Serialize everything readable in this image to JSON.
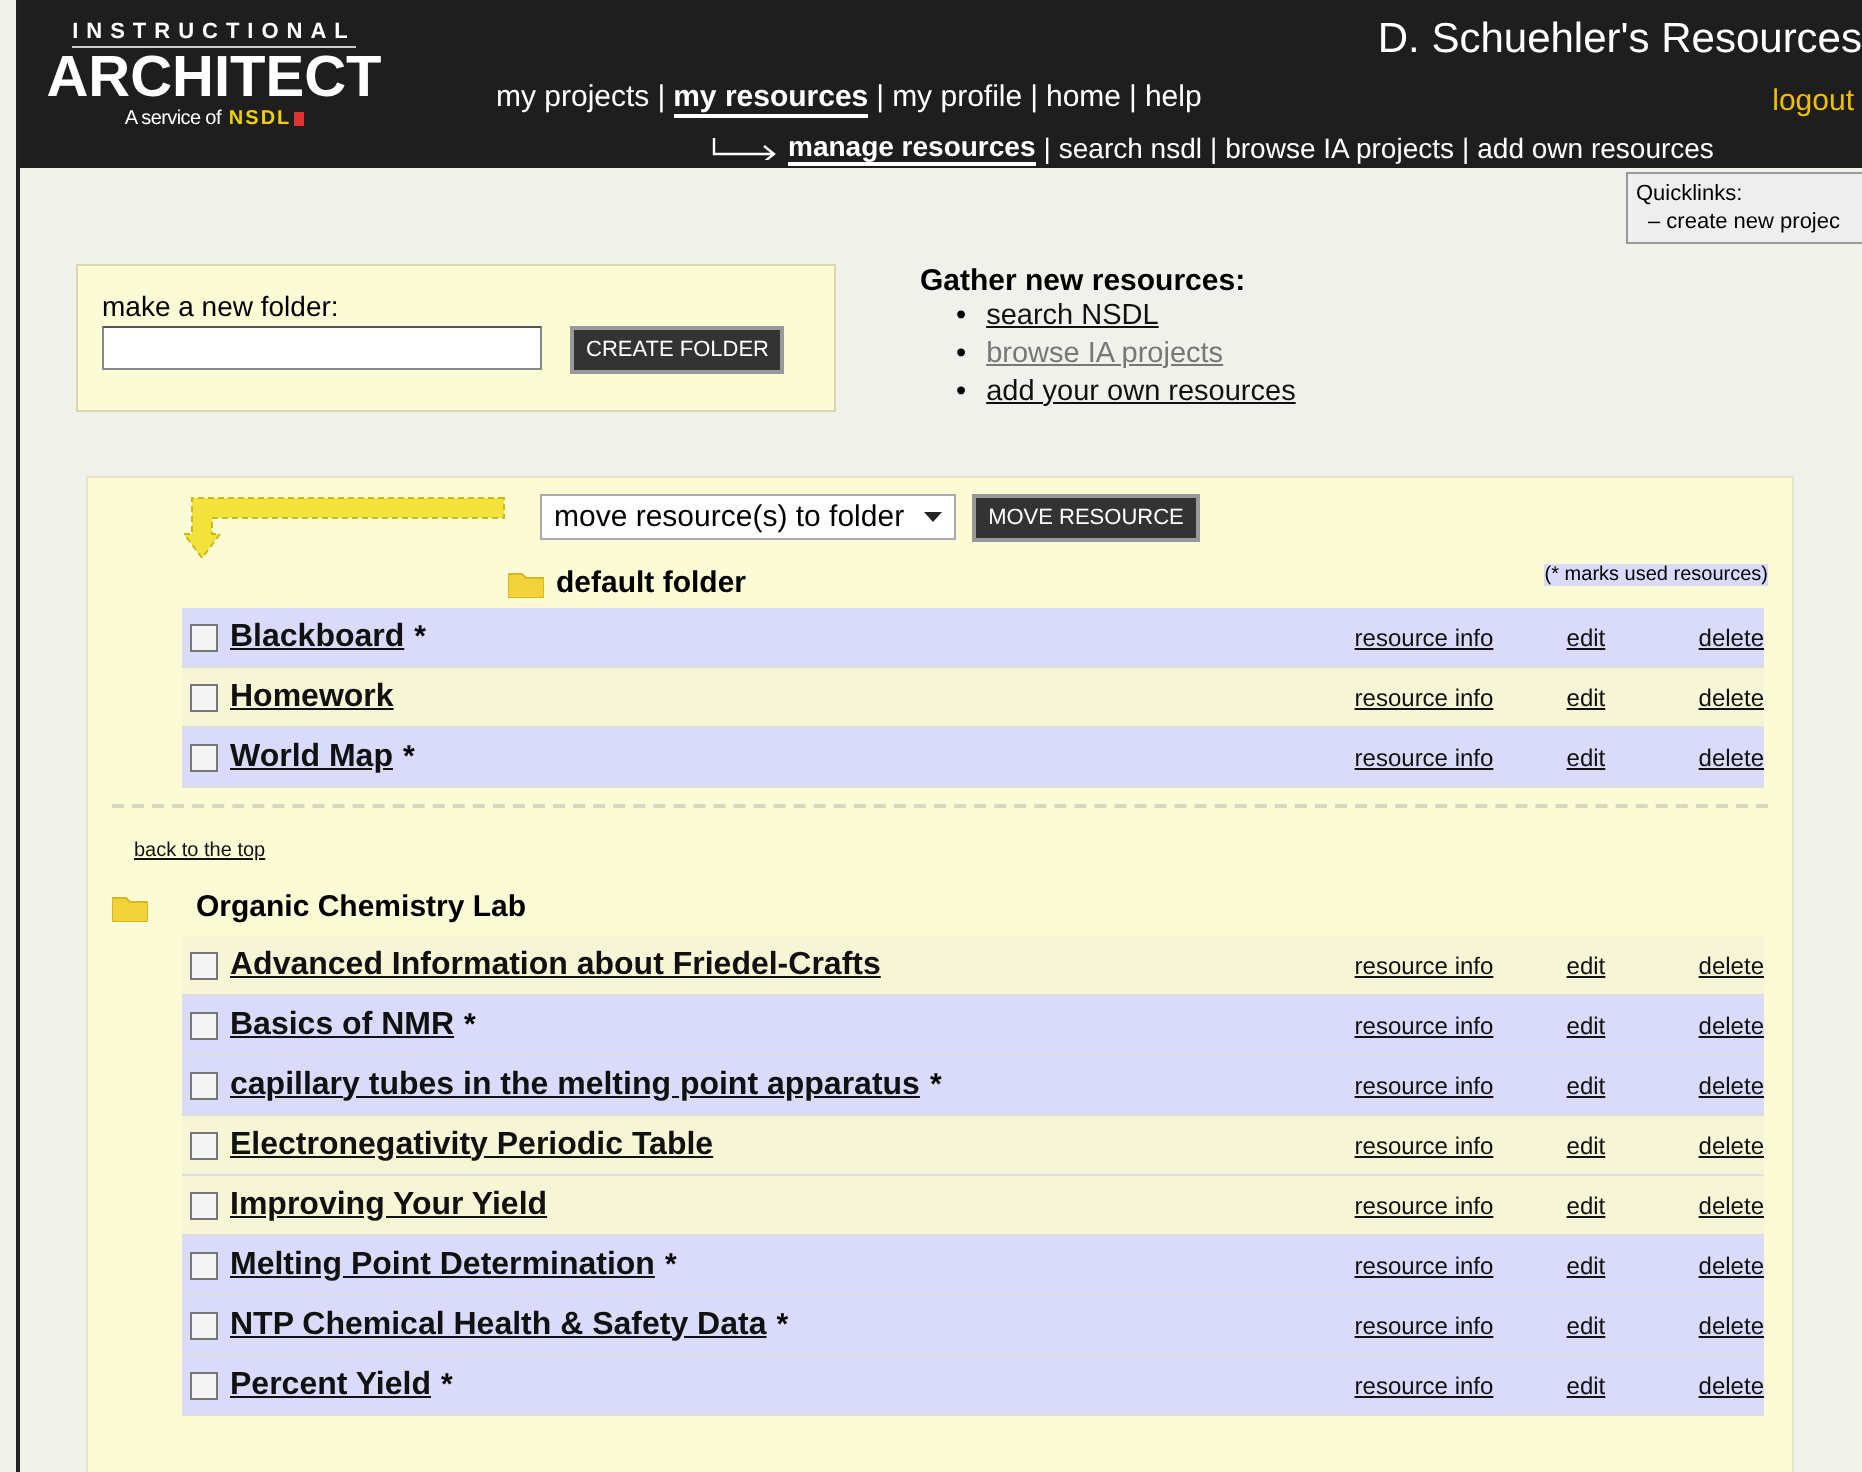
{
  "header": {
    "logo": {
      "top": "INSTRUCTIONAL",
      "main": "ARCHITECT",
      "service": "A service of",
      "brand": "NSDL"
    },
    "title": "D. Schuehler's Resources",
    "logout": "logout",
    "nav": {
      "separator": "|",
      "items": [
        {
          "label": "my projects",
          "selected": false
        },
        {
          "label": "my resources",
          "selected": true
        },
        {
          "label": "my profile",
          "selected": false
        },
        {
          "label": "home",
          "selected": false
        },
        {
          "label": "help",
          "selected": false
        }
      ]
    },
    "subnav": {
      "separator": "|",
      "items": [
        {
          "label": "manage resources",
          "selected": true
        },
        {
          "label": "search nsdl",
          "selected": false
        },
        {
          "label": "browse IA projects",
          "selected": false
        },
        {
          "label": "add own resources",
          "selected": false
        }
      ]
    }
  },
  "quicklinks": {
    "title": "Quicklinks:",
    "items": [
      "– create new projec"
    ]
  },
  "new_folder": {
    "label": "make a new folder:",
    "button": "CREATE FOLDER"
  },
  "gather": {
    "title": "Gather new resources:",
    "links": [
      {
        "marker": "•",
        "label": "search NSDL",
        "visited": false
      },
      {
        "marker": "•",
        "label": "browse IA projects",
        "visited": true
      },
      {
        "marker": "•",
        "label": "add your own resources",
        "visited": false
      }
    ]
  },
  "move": {
    "select": "move resource(s) to folder",
    "button": "MOVE RESOURCE",
    "note": "(* marks used resources)"
  },
  "folders": [
    {
      "name": "default folder",
      "rows": [
        {
          "title": "Blackboard",
          "mark": "*",
          "used": true,
          "checked": false,
          "info": "resource info",
          "edit": "edit",
          "delete": "delete"
        },
        {
          "title": "Homework",
          "used": false,
          "checked": false,
          "info": "resource info",
          "edit": "edit",
          "delete": "delete"
        },
        {
          "title": "World Map",
          "mark": "*",
          "used": true,
          "checked": false,
          "info": "resource info",
          "edit": "edit",
          "delete": "delete"
        }
      ]
    },
    {
      "name": "Organic Chemistry Lab",
      "back_link": "back to the top",
      "rows": [
        {
          "title": "Advanced Information about Friedel-Crafts",
          "used": false,
          "checked": false,
          "info": "resource info",
          "edit": "edit",
          "delete": "delete"
        },
        {
          "title": "Basics of NMR",
          "mark": "*",
          "used": true,
          "checked": false,
          "info": "resource info",
          "edit": "edit",
          "delete": "delete"
        },
        {
          "title": "capillary tubes in the melting point apparatus",
          "mark": "*",
          "used": true,
          "checked": false,
          "info": "resource info",
          "edit": "edit",
          "delete": "delete"
        },
        {
          "title": "Electronegativity Periodic Table",
          "used": false,
          "checked": false,
          "info": "resource info",
          "edit": "edit",
          "delete": "delete"
        },
        {
          "title": "Improving Your Yield",
          "used": false,
          "checked": false,
          "info": "resource info",
          "edit": "edit",
          "delete": "delete"
        },
        {
          "title": "Melting Point Determination",
          "mark": "*",
          "used": true,
          "checked": false,
          "info": "resource info",
          "edit": "edit",
          "delete": "delete"
        },
        {
          "title": "NTP Chemical Health & Safety Data",
          "mark": "*",
          "used": true,
          "checked": false,
          "info": "resource info",
          "edit": "edit",
          "delete": "delete"
        },
        {
          "title": "Percent Yield",
          "mark": "*",
          "used": true,
          "checked": false,
          "info": "resource info",
          "edit": "edit",
          "delete": "delete"
        }
      ]
    }
  ]
}
